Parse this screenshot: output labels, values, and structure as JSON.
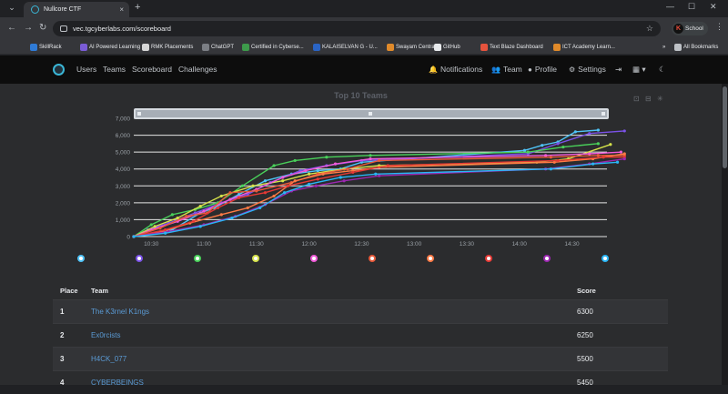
{
  "browser": {
    "tab_title": "Nullcore CTF",
    "tab_close": "×",
    "new_tab": "+",
    "url": "vec.tgcyberlabs.com/scoreboard",
    "profile_label": "School",
    "profile_initial": "K",
    "back": "←",
    "forward": "→",
    "reload": "↻",
    "star": "☆",
    "menu": "⋮",
    "tab_menu": "⌄",
    "minimize": "—",
    "maximize": "☐",
    "close": "✕"
  },
  "bookmarks": [
    {
      "label": "SkillRack",
      "color": "#2f7bd6"
    },
    {
      "label": "AI Powered Learning",
      "color": "#7a5cd6"
    },
    {
      "label": "RMK Placements",
      "color": "#d6d6d6"
    },
    {
      "label": "ChatGPT",
      "color": "#7c7f85"
    },
    {
      "label": "Certified in Cyberse...",
      "color": "#3d9a4b"
    },
    {
      "label": "KALAISELVAN G - U...",
      "color": "#2a64c4"
    },
    {
      "label": "Swayam Central",
      "color": "#e08a2a"
    },
    {
      "label": "GitHub",
      "color": "#e8eaed"
    },
    {
      "label": "Text Blaze Dashboard",
      "color": "#e5533d"
    },
    {
      "label": "ICT Academy Learn...",
      "color": "#e08a2a"
    },
    {
      "label": "All Bookmarks",
      "color": "#bdc1c6"
    }
  ],
  "bookmarks_overflow": "»",
  "site_nav": {
    "links": [
      "Users",
      "Teams",
      "Scoreboard",
      "Challenges"
    ],
    "right": [
      {
        "icon": "bell-icon",
        "glyph": "🔔",
        "label": "Notifications"
      },
      {
        "icon": "users-icon",
        "glyph": "👥",
        "label": "Team"
      },
      {
        "icon": "user-circle-icon",
        "glyph": "●",
        "label": "Profile"
      },
      {
        "icon": "gear-icon",
        "glyph": "⚙",
        "label": "Settings"
      }
    ],
    "logout_glyph": "⇥",
    "language_glyph": "▦ ▾",
    "theme_glyph": "☾"
  },
  "chart_tools": [
    "⊡",
    "⊟",
    "✳"
  ],
  "chart_data": {
    "type": "line",
    "title": "Top 10 Teams",
    "ylim": [
      0,
      7000
    ],
    "yticks": [
      "0",
      "1,000",
      "2,000",
      "3,000",
      "4,000",
      "5,000",
      "6,000",
      "7,000"
    ],
    "xticks": [
      "10:30",
      "11:00",
      "11:30",
      "12:00",
      "12:30",
      "13:00",
      "13:30",
      "14:00",
      "14:30"
    ],
    "x_unit_note": "minutes after 10:00",
    "grid": true,
    "legend_position": "bottom",
    "series": [
      {
        "color": "#4fc3f7",
        "points": [
          [
            20,
            0
          ],
          [
            42,
            400
          ],
          [
            58,
            1400
          ],
          [
            66,
            1700
          ],
          [
            80,
            2500
          ],
          [
            95,
            3300
          ],
          [
            110,
            3700
          ],
          [
            125,
            3900
          ],
          [
            138,
            4000
          ],
          [
            150,
            4400
          ],
          [
            243,
            5100
          ],
          [
            253,
            5400
          ],
          [
            262,
            5600
          ],
          [
            272,
            6200
          ],
          [
            285,
            6300
          ]
        ]
      },
      {
        "color": "#7b52e8",
        "points": [
          [
            20,
            0
          ],
          [
            28,
            400
          ],
          [
            40,
            800
          ],
          [
            55,
            1400
          ],
          [
            70,
            2000
          ],
          [
            85,
            2500
          ],
          [
            98,
            3200
          ],
          [
            115,
            3900
          ],
          [
            130,
            4200
          ],
          [
            150,
            4500
          ],
          [
            245,
            4900
          ],
          [
            262,
            5500
          ],
          [
            280,
            6100
          ],
          [
            300,
            6250
          ]
        ]
      },
      {
        "color": "#49d15a",
        "points": [
          [
            20,
            0
          ],
          [
            30,
            700
          ],
          [
            42,
            1300
          ],
          [
            55,
            1600
          ],
          [
            68,
            2000
          ],
          [
            82,
            3000
          ],
          [
            100,
            4200
          ],
          [
            112,
            4500
          ],
          [
            130,
            4700
          ],
          [
            155,
            4800
          ],
          [
            245,
            5000
          ],
          [
            265,
            5300
          ],
          [
            285,
            5500
          ]
        ]
      },
      {
        "color": "#d5e24a",
        "points": [
          [
            20,
            0
          ],
          [
            32,
            600
          ],
          [
            45,
            1100
          ],
          [
            58,
            1800
          ],
          [
            70,
            2400
          ],
          [
            88,
            3000
          ],
          [
            105,
            3300
          ],
          [
            120,
            3700
          ],
          [
            140,
            4000
          ],
          [
            160,
            4200
          ],
          [
            250,
            4400
          ],
          [
            268,
            4600
          ],
          [
            292,
            5450
          ]
        ]
      },
      {
        "color": "#f05ad8",
        "points": [
          [
            20,
            0
          ],
          [
            30,
            400
          ],
          [
            45,
            900
          ],
          [
            60,
            1500
          ],
          [
            75,
            2200
          ],
          [
            90,
            2800
          ],
          [
            105,
            3500
          ],
          [
            118,
            3900
          ],
          [
            135,
            4300
          ],
          [
            155,
            4600
          ],
          [
            255,
            4800
          ],
          [
            280,
            4900
          ],
          [
            298,
            5000
          ]
        ]
      },
      {
        "color": "#e85a3a",
        "points": [
          [
            20,
            0
          ],
          [
            35,
            500
          ],
          [
            50,
            1200
          ],
          [
            62,
            1400
          ],
          [
            75,
            2600
          ],
          [
            90,
            2700
          ],
          [
            110,
            3200
          ],
          [
            125,
            3700
          ],
          [
            142,
            4000
          ],
          [
            160,
            4500
          ],
          [
            258,
            4700
          ],
          [
            285,
            4800
          ],
          [
            300,
            4800
          ]
        ]
      },
      {
        "color": "#ff7a45",
        "points": [
          [
            20,
            0
          ],
          [
            36,
            300
          ],
          [
            52,
            800
          ],
          [
            70,
            1300
          ],
          [
            85,
            1700
          ],
          [
            100,
            2400
          ],
          [
            112,
            3300
          ],
          [
            128,
            3700
          ],
          [
            145,
            3900
          ],
          [
            160,
            4100
          ],
          [
            260,
            4400
          ],
          [
            282,
            4600
          ],
          [
            300,
            4900
          ]
        ]
      },
      {
        "color": "#e53935",
        "points": [
          [
            20,
            0
          ],
          [
            38,
            400
          ],
          [
            54,
            900
          ],
          [
            68,
            1700
          ],
          [
            80,
            2300
          ],
          [
            95,
            2600
          ],
          [
            108,
            3000
          ],
          [
            125,
            3400
          ],
          [
            145,
            3800
          ],
          [
            165,
            4200
          ],
          [
            262,
            4500
          ],
          [
            288,
            4700
          ],
          [
            300,
            4700
          ]
        ]
      },
      {
        "color": "#9c27b0",
        "points": [
          [
            20,
            0
          ],
          [
            40,
            300
          ],
          [
            60,
            700
          ],
          [
            78,
            1200
          ],
          [
            95,
            1900
          ],
          [
            110,
            2700
          ],
          [
            124,
            3000
          ],
          [
            140,
            3300
          ],
          [
            160,
            3600
          ],
          [
            255,
            4000
          ],
          [
            280,
            4300
          ],
          [
            300,
            4600
          ]
        ]
      },
      {
        "color": "#29b6f6",
        "points": [
          [
            20,
            0
          ],
          [
            38,
            200
          ],
          [
            58,
            600
          ],
          [
            76,
            1100
          ],
          [
            92,
            1700
          ],
          [
            106,
            2600
          ],
          [
            120,
            3100
          ],
          [
            138,
            3500
          ],
          [
            158,
            3700
          ],
          [
            258,
            4000
          ],
          [
            282,
            4300
          ],
          [
            296,
            4400
          ]
        ]
      }
    ]
  },
  "scoreboard": {
    "headers": {
      "place": "Place",
      "team": "Team",
      "score": "Score"
    },
    "rows": [
      {
        "place": "1",
        "team": "The K3rnel K1ngs",
        "score": "6300"
      },
      {
        "place": "2",
        "team": "Ex0rcists",
        "score": "6250"
      },
      {
        "place": "3",
        "team": "H4CK_077",
        "score": "5500"
      },
      {
        "place": "4",
        "team": "CYBERBEINGS",
        "score": "5450"
      }
    ]
  }
}
